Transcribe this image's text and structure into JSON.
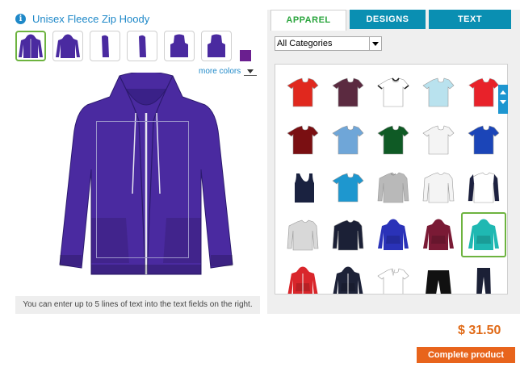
{
  "product": {
    "title": "Unisex Fleece Zip Hoody",
    "color": "#4a2aa0",
    "swatch_color": "#6a1f8f",
    "views": [
      "front",
      "back",
      "left-side",
      "right-side",
      "front-hood",
      "back-hood"
    ]
  },
  "more_colors_label": "more colors",
  "hint": "You can enter up to 5 lines of text into the text fields on the right.",
  "tabs": [
    {
      "label": "APPAREL",
      "active": true
    },
    {
      "label": "DESIGNS",
      "active": false
    },
    {
      "label": "TEXT",
      "active": false
    }
  ],
  "category_select": {
    "value": "All Categories"
  },
  "catalog": [
    {
      "kind": "tee",
      "color": "#e0281e"
    },
    {
      "kind": "tee",
      "color": "#5b2a40"
    },
    {
      "kind": "ringer",
      "color": "#ffffff",
      "trim": "#222222"
    },
    {
      "kind": "tee",
      "color": "#b9e2ee"
    },
    {
      "kind": "ringer",
      "color": "#e8222a",
      "trim": "#ffffff"
    },
    {
      "kind": "tee",
      "color": "#7a0f12"
    },
    {
      "kind": "tee",
      "color": "#6fa6d8"
    },
    {
      "kind": "tee",
      "color": "#0f5a25"
    },
    {
      "kind": "tee",
      "color": "#f4f4f4"
    },
    {
      "kind": "tee",
      "color": "#1b45b8"
    },
    {
      "kind": "tank",
      "color": "#1a2240"
    },
    {
      "kind": "tee",
      "color": "#1e97cf"
    },
    {
      "kind": "sweat",
      "color": "#b9b9b9"
    },
    {
      "kind": "longsleeve",
      "color": "#f4f4f4"
    },
    {
      "kind": "raglan",
      "color": "#ffffff",
      "trim": "#1d2140"
    },
    {
      "kind": "longsleeve",
      "color": "#d8d8d8"
    },
    {
      "kind": "longsleeve",
      "color": "#1b2036"
    },
    {
      "kind": "hoodie",
      "color": "#2a32b8"
    },
    {
      "kind": "hoodie",
      "color": "#7a1a35"
    },
    {
      "kind": "hoodie",
      "color": "#1fb8b2",
      "selected": true
    },
    {
      "kind": "zip",
      "color": "#d9262b"
    },
    {
      "kind": "zip",
      "color": "#1d2238"
    },
    {
      "kind": "polo",
      "color": "#ffffff"
    },
    {
      "kind": "shorts",
      "color": "#111111"
    },
    {
      "kind": "pants",
      "color": "#1b2036"
    }
  ],
  "price": "$ 31.50",
  "complete_label": "Complete product"
}
